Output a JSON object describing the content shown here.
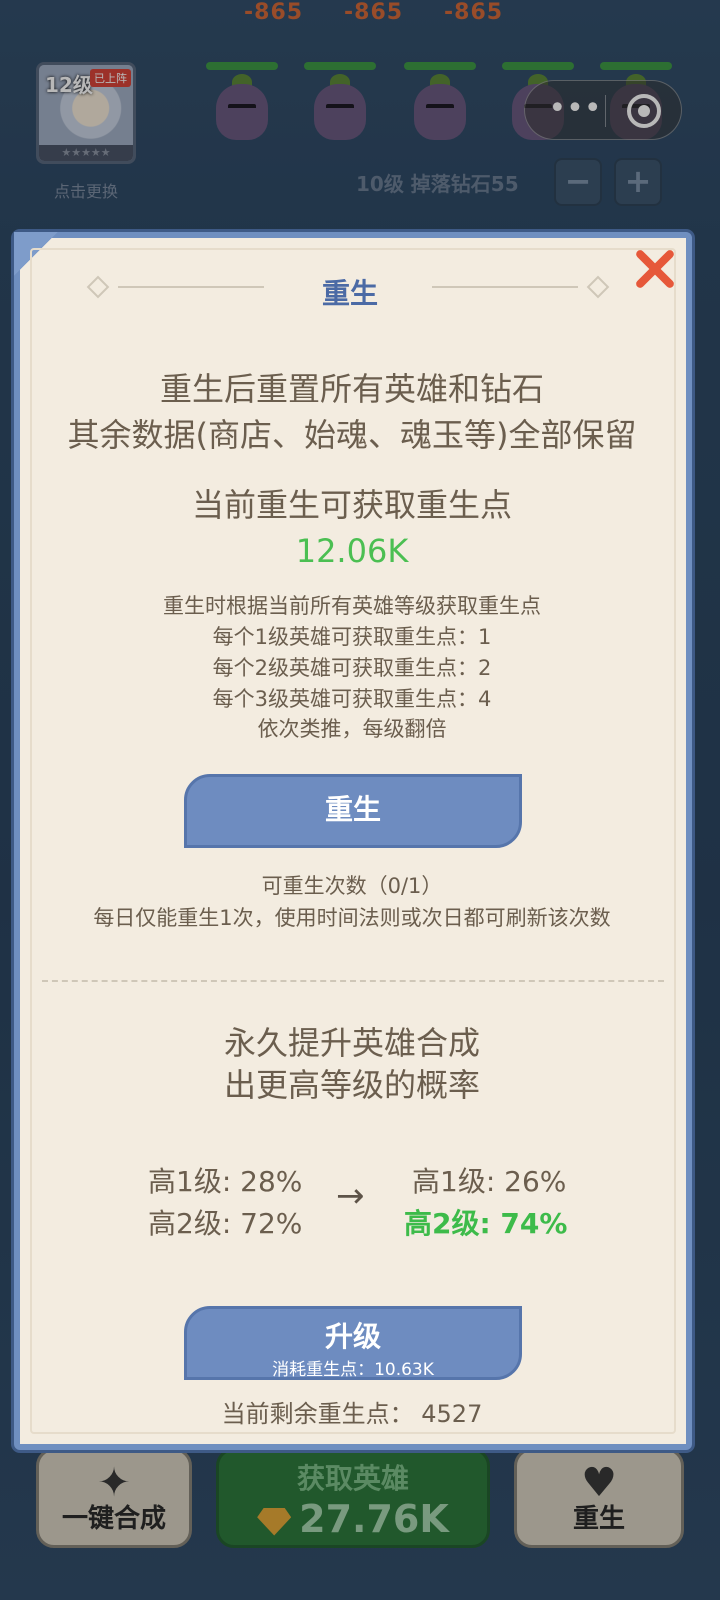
{
  "game": {
    "damage_numbers": [
      "-865",
      "-865",
      "-865"
    ],
    "hero_card": {
      "level": "12级",
      "status_badge": "已上阵",
      "stars": "★★★★★",
      "swap_label": "点击更换"
    },
    "level_info": "10级 掉落钻石55",
    "minus_label": "−",
    "plus_label": "+",
    "capsule_more": "•••"
  },
  "bottom_bar": {
    "merge_label": "一键合成",
    "get_hero_title": "获取英雄",
    "get_hero_cost": "27.76K",
    "rebirth_label": "重生"
  },
  "modal": {
    "title": "重生",
    "intro_line1": "重生后重置所有英雄和钻石",
    "intro_line2": "其余数据(商店、始魂、魂玉等)全部保留",
    "points_label": "当前重生可获取重生点",
    "points_value": "12.06K",
    "rules": [
      "重生时根据当前所有英雄等级获取重生点",
      "每个1级英雄可获取重生点：1",
      "每个2级英雄可获取重生点：2",
      "每个3级英雄可获取重生点：4",
      "依次类推，每级翻倍"
    ],
    "rebirth_button": "重生",
    "rebirth_count": "可重生次数（0/1）",
    "rebirth_note": "每日仅能重生1次，使用时间法则或次日都可刷新该次数",
    "upgrade_line1": "永久提升英雄合成",
    "upgrade_line2": "出更高等级的概率",
    "current": [
      "高1级: 28%",
      "高2级: 72%"
    ],
    "next": [
      "高1级: 26%",
      "高2级: 74%"
    ],
    "arrow": "→",
    "upgrade_button": "升级",
    "upgrade_cost": "消耗重生点：10.63K",
    "remaining": "当前剩余重生点：  4527"
  },
  "colors": {
    "accent_blue": "#6e8cc0",
    "points_green": "#4bbf52",
    "close_red": "#e6583a"
  }
}
